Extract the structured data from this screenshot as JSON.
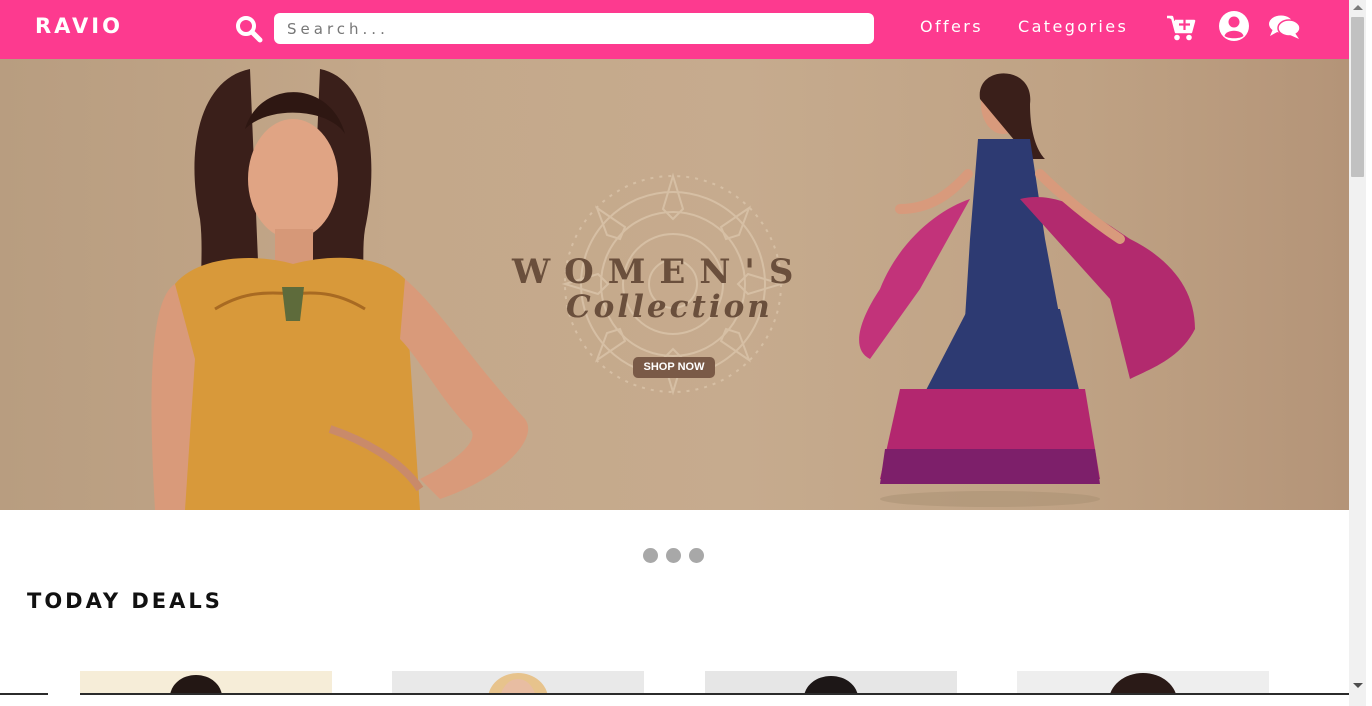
{
  "brand": {
    "logo_text": "RAVIO",
    "accent_color": "#fd3a8f"
  },
  "search": {
    "placeholder": "Search...",
    "icon": "search-icon"
  },
  "nav": {
    "offers_label": "Offers",
    "categories_label": "Categories",
    "icons": [
      "cart-plus-icon",
      "user-circle-icon",
      "comments-icon"
    ]
  },
  "hero": {
    "title": "WOMEN'S",
    "subtitle": "Collection",
    "cta_label": "SHOP NOW",
    "slide_count": 3
  },
  "deals": {
    "section_title": "TODAY DEALS",
    "card_count": 4
  }
}
